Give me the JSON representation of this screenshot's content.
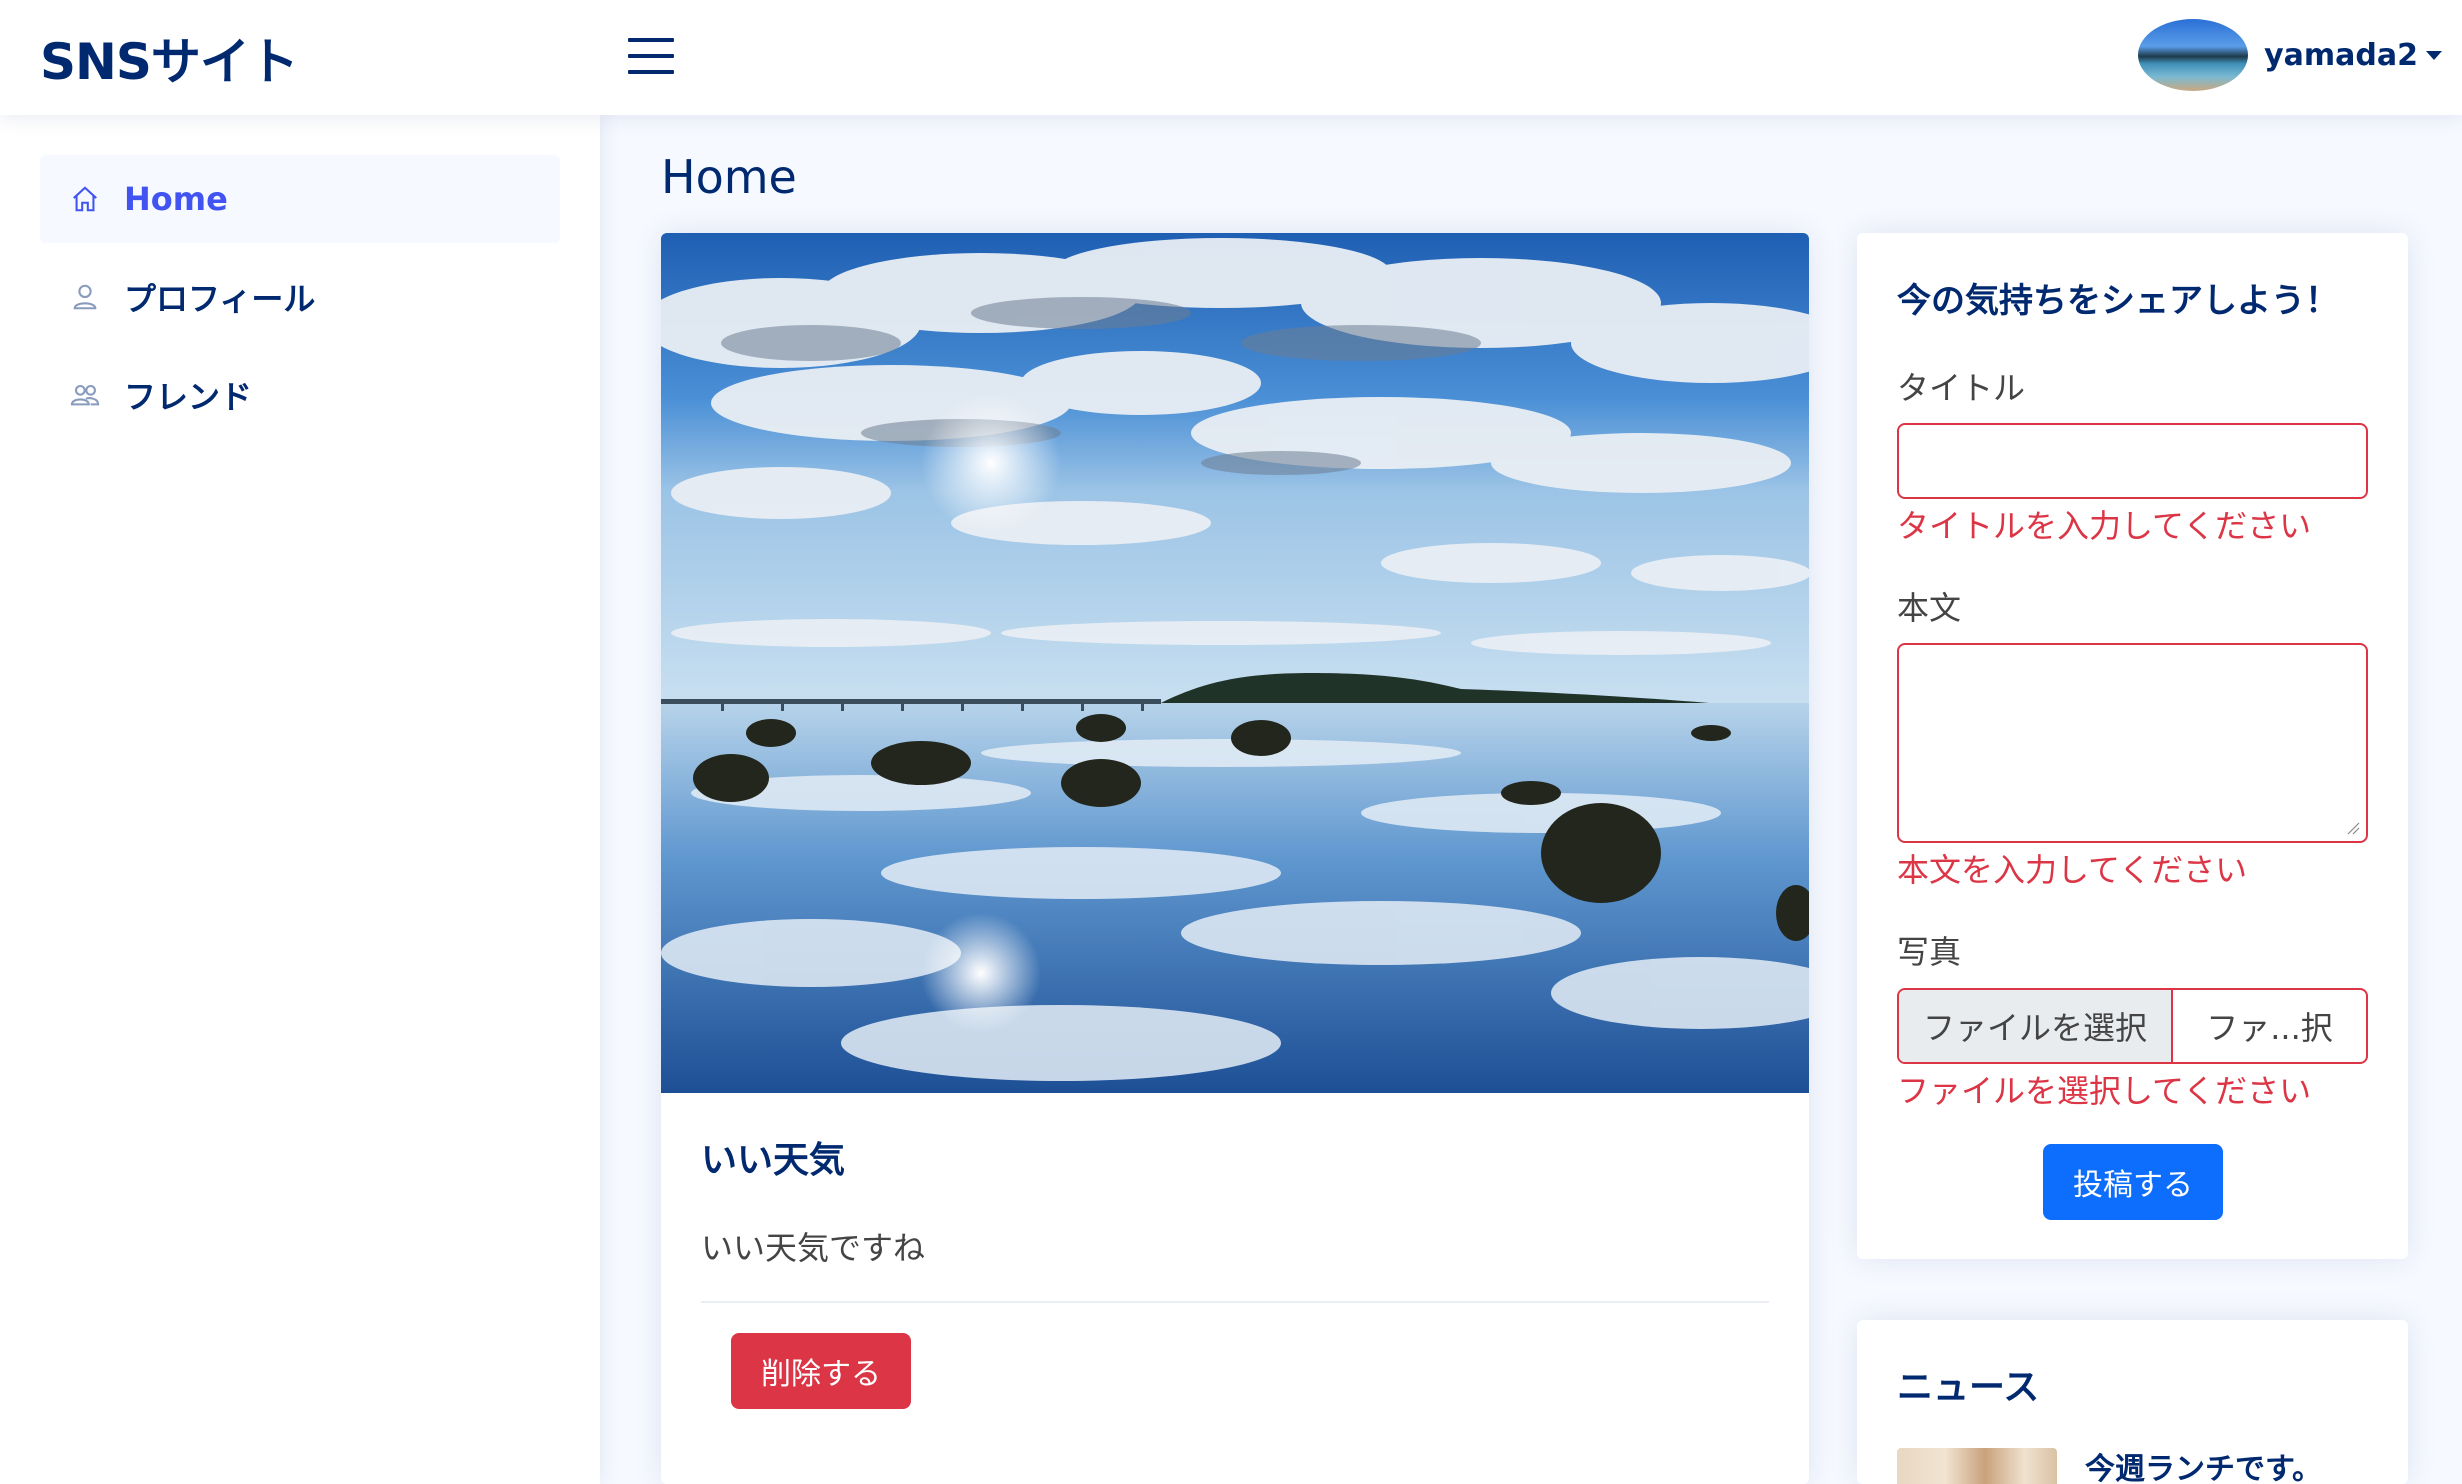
{
  "header": {
    "logo": "SNSサイト",
    "username": "yamada2"
  },
  "sidebar": {
    "items": [
      {
        "label": "Home",
        "icon": "house-icon",
        "active": true
      },
      {
        "label": "プロフィール",
        "icon": "person-icon",
        "active": false
      },
      {
        "label": "フレンド",
        "icon": "people-icon",
        "active": false
      }
    ]
  },
  "main": {
    "page_title": "Home",
    "post": {
      "title": "いい天気",
      "body": "いい天気ですね",
      "delete_label": "削除する"
    }
  },
  "form": {
    "heading": "今の気持ちをシェアしよう！",
    "title_label": "タイトル",
    "title_value": "",
    "title_error": "タイトルを入力してください",
    "body_label": "本文",
    "body_value": "",
    "body_error": "本文を入力してください",
    "photo_label": "写真",
    "file_button": "ファイルを選択",
    "file_name": "ファ...択",
    "photo_error": "ファイルを選択してください",
    "submit_label": "投稿する"
  },
  "news": {
    "heading": "ニュース",
    "items": [
      {
        "title": "今週ランチです。"
      }
    ]
  },
  "colors": {
    "primary": "#012970",
    "accent": "#4154f1",
    "danger": "#dc3545",
    "button_primary": "#0d6efd",
    "background": "#f6f9ff"
  }
}
